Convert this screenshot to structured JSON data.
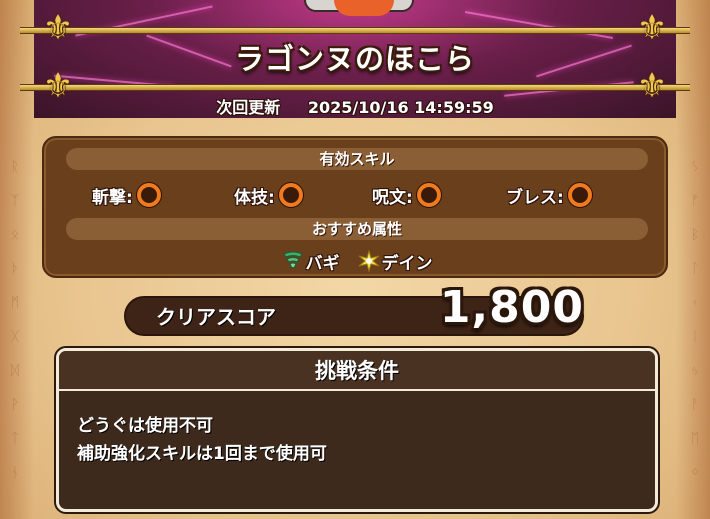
{
  "header": {
    "title": "ラゴンヌのほこら",
    "next_update_label": "次回更新",
    "next_update_value": "2025/10/16 14:59:59"
  },
  "effective_skills": {
    "heading": "有効スキル",
    "items": [
      {
        "label": "斬撃:",
        "mark": "circle"
      },
      {
        "label": "体技:",
        "mark": "circle"
      },
      {
        "label": "呪文:",
        "mark": "circle"
      },
      {
        "label": "ブレス:",
        "mark": "circle"
      }
    ]
  },
  "recommended_attributes": {
    "heading": "おすすめ属性",
    "items": [
      {
        "label": "バギ",
        "icon": "tornado-icon",
        "color": "#3fae6a"
      },
      {
        "label": "デイン",
        "icon": "lightning-burst-icon",
        "color": "#f5e04a"
      }
    ]
  },
  "score": {
    "label": "クリアスコア",
    "value": "1,800"
  },
  "challenge": {
    "heading": "挑戦条件",
    "conditions": [
      "どうぐは使用不可",
      "補助強化スキルは1回まで使用可"
    ]
  },
  "colors": {
    "accent_orange": "#f07a1e",
    "panel_brown": "#6a3f1c",
    "banner_magenta": "#c23a8a"
  }
}
